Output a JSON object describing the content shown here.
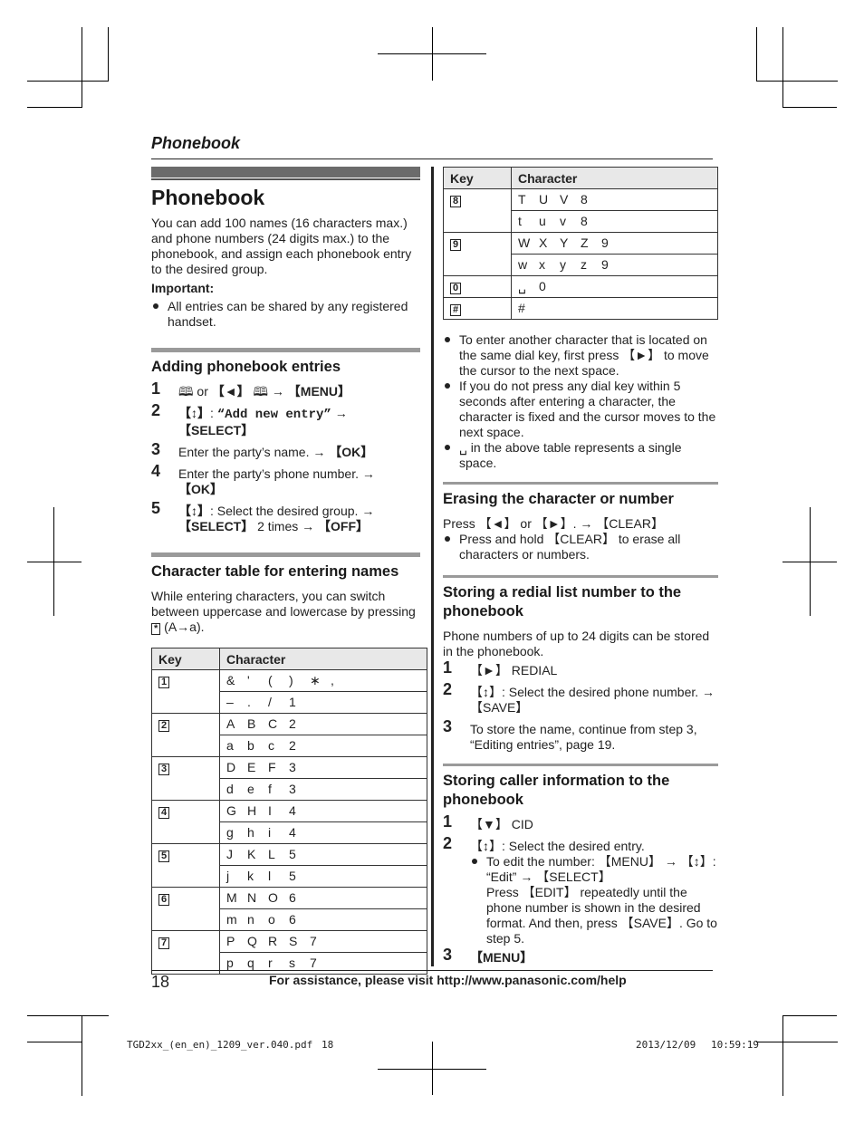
{
  "header": {
    "title": "Phonebook"
  },
  "left": {
    "h1": "Phonebook",
    "intro": "You can add 100 names (16 characters max.) and phone numbers (24 digits max.) to the phonebook, and assign each phonebook entry to the desired group.",
    "important_label": "Important:",
    "important_bullet": "All entries can be shared by any registered handset.",
    "adding": {
      "title": "Adding phonebook entries",
      "steps": [
        {
          "n": "1",
          "html": "⬜⬜ or 【◄】 ⬜⬜ → 【MENU】"
        },
        {
          "n": "2",
          "text": "【↕】: “Add new entry” → 【SELECT】"
        },
        {
          "n": "3",
          "text": "Enter the party’s name. → 【OK】"
        },
        {
          "n": "4",
          "text": "Enter the party’s phone number. → 【OK】"
        },
        {
          "n": "5",
          "text": "【↕】: Select the desired group. → 【SELECT】 2 times → 【OFF】"
        }
      ],
      "step1": {
        "or": "or",
        "menu": "【MENU】"
      },
      "step2": {
        "pre": ": ",
        "entry": "“Add new entry”",
        "select": "【SELECT】"
      },
      "step3": {
        "text": "Enter the party’s name.",
        "ok": "【OK】"
      },
      "step4": {
        "text": "Enter the party’s phone number.",
        "ok": "【OK】"
      },
      "step5": {
        "text": ": Select the desired group.",
        "select": "【SELECT】",
        "times": " 2 times ",
        "off": "【OFF】"
      }
    },
    "chartable": {
      "title": "Character table for entering names",
      "intro": "While entering characters, you can switch between uppercase and lowercase by pressing",
      "intro_key": "*",
      "intro_tail": "(A→a)."
    }
  },
  "table_headers": {
    "key": "Key",
    "character": "Character"
  },
  "table_left": [
    {
      "key": "1",
      "rows": [
        [
          "&",
          "'",
          "(",
          ")",
          "∗",
          ","
        ],
        [
          "–",
          ".",
          "/",
          "1"
        ]
      ]
    },
    {
      "key": "2",
      "rows": [
        [
          "A",
          "B",
          "C",
          "2"
        ],
        [
          "a",
          "b",
          "c",
          "2"
        ]
      ]
    },
    {
      "key": "3",
      "rows": [
        [
          "D",
          "E",
          "F",
          "3"
        ],
        [
          "d",
          "e",
          "f",
          "3"
        ]
      ]
    },
    {
      "key": "4",
      "rows": [
        [
          "G",
          "H",
          "I",
          "4"
        ],
        [
          "g",
          "h",
          "i",
          "4"
        ]
      ]
    },
    {
      "key": "5",
      "rows": [
        [
          "J",
          "K",
          "L",
          "5"
        ],
        [
          "j",
          "k",
          "l",
          "5"
        ]
      ]
    },
    {
      "key": "6",
      "rows": [
        [
          "M",
          "N",
          "O",
          "6"
        ],
        [
          "m",
          "n",
          "o",
          "6"
        ]
      ]
    },
    {
      "key": "7",
      "rows": [
        [
          "P",
          "Q",
          "R",
          "S",
          "7"
        ],
        [
          "p",
          "q",
          "r",
          "s",
          "7"
        ]
      ]
    }
  ],
  "table_right": [
    {
      "key": "8",
      "rows": [
        [
          "T",
          "U",
          "V",
          "8"
        ],
        [
          "t",
          "u",
          "v",
          "8"
        ]
      ]
    },
    {
      "key": "9",
      "rows": [
        [
          "W",
          "X",
          "Y",
          "Z",
          "9"
        ],
        [
          "w",
          "x",
          "y",
          "z",
          "9"
        ]
      ]
    },
    {
      "key": "0",
      "rows": [
        [
          "␣",
          "0"
        ]
      ]
    },
    {
      "key": "#",
      "rows": [
        [
          "#"
        ]
      ]
    }
  ],
  "right": {
    "bullets": [
      "To enter another character that is located on the same dial key, first press 【►】 to move the cursor to the next space.",
      "If you do not press any dial key within 5 seconds after entering a character, the character is fixed and the cursor moves to the next space.",
      "␣ in the above table represents a single space."
    ],
    "erasing": {
      "title": "Erasing the character or number",
      "line": "Press 【◄】 or 【►】. → 【CLEAR】",
      "bullet": "Press and hold 【CLEAR】 to erase all characters or numbers."
    },
    "redial": {
      "title": "Storing a redial list number to the phonebook",
      "intro": "Phone numbers of up to 24 digits can be stored in the phonebook.",
      "steps": [
        {
          "n": "1",
          "text": "【►】 REDIAL"
        },
        {
          "n": "2",
          "text": "【↕】: Select the desired phone number. → 【SAVE】"
        },
        {
          "n": "3",
          "text": "To store the name, continue from step 3, “Editing entries”, page 19."
        }
      ]
    },
    "caller": {
      "title": "Storing caller information to the phonebook",
      "steps": [
        {
          "n": "1",
          "text": "【▼】 CID"
        },
        {
          "n": "2",
          "text": "【↕】: Select the desired entry."
        },
        {
          "n": "3",
          "text": "【MENU】"
        }
      ],
      "sub_bullet": "To edit the number: 【MENU】 → 【↕】: “Edit” → 【SELECT】",
      "sub_text": "Press 【EDIT】 repeatedly until the phone number is shown in the desired format. And then, press 【SAVE】. Go to step 5."
    }
  },
  "footer": {
    "page_number": "18",
    "assistance": "For assistance, please visit http://www.panasonic.com/help",
    "file": "TGD2xx_(en_en)_1209_ver.040.pdf",
    "file_page": "18",
    "date": "2013/12/09",
    "time": "10:59:19"
  }
}
